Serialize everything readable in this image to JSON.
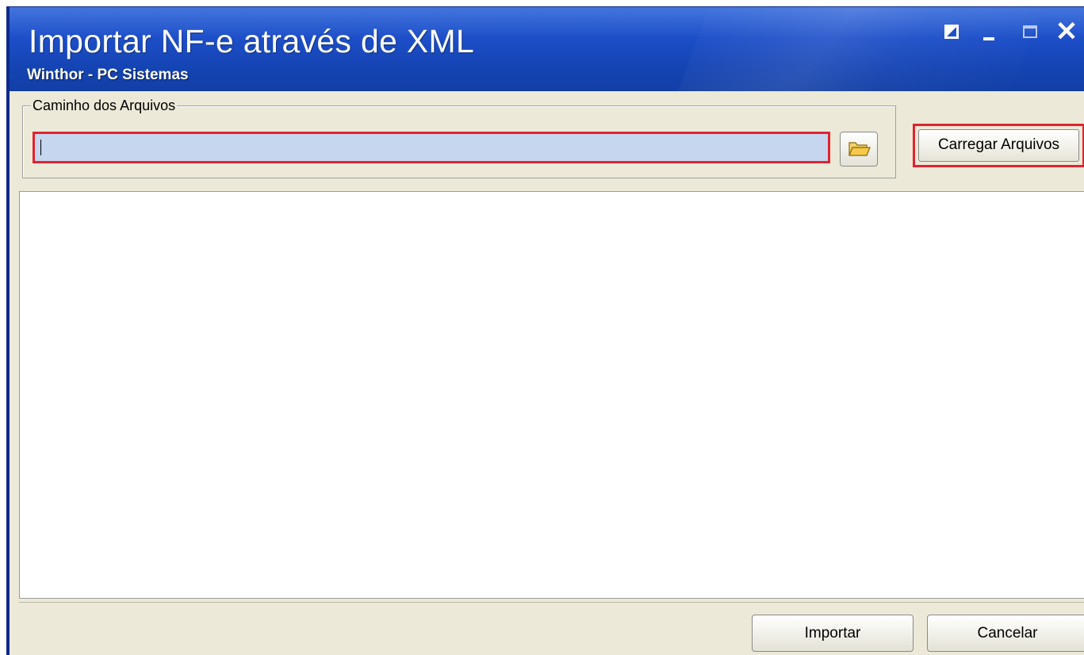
{
  "window": {
    "title": "Importar NF-e através de XML",
    "subtitle": "Winthor - PC Sistemas",
    "controls": [
      "restore-icon",
      "minimize-icon",
      "maximize-icon",
      "close-icon"
    ],
    "close_glyph": "✕"
  },
  "path_group": {
    "legend": "Caminho dos Arquivos",
    "path_value": "",
    "browse_icon": "folder-open-icon"
  },
  "actions": {
    "load_label": "Carregar Arquivos",
    "import_label": "Importar",
    "cancel_label": "Cancelar"
  },
  "colors": {
    "titlebar": "#1d4fc9",
    "highlight": "#e0242f",
    "input_bg": "#c6d6ef",
    "window_bg": "#ece9d8"
  }
}
